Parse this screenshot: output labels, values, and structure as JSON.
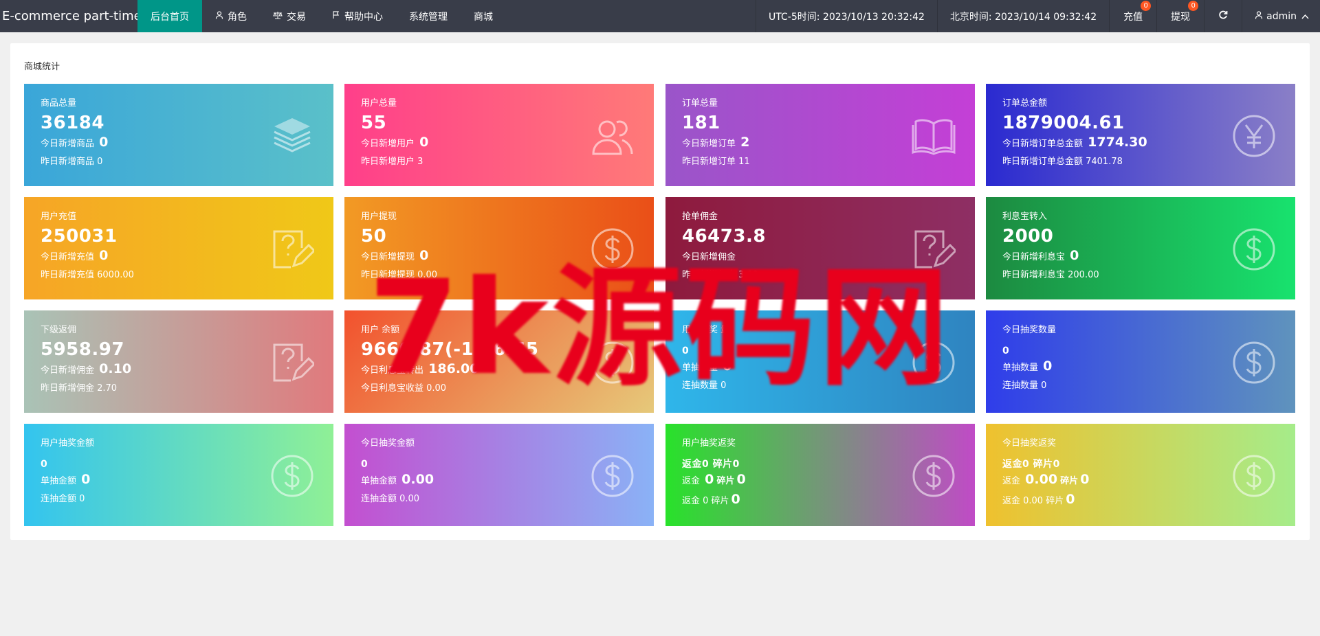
{
  "header": {
    "brand": "E-commerce part-time",
    "nav": [
      {
        "label": "后台首页",
        "icon": "",
        "active": true
      },
      {
        "label": "角色",
        "icon": "user-icon"
      },
      {
        "label": "交易",
        "icon": "scale-icon"
      },
      {
        "label": "帮助中心",
        "icon": "flag-icon"
      },
      {
        "label": "系统管理",
        "icon": ""
      },
      {
        "label": "商城",
        "icon": ""
      }
    ],
    "utc_time": "UTC-5时间: 2023/10/13 20:32:42",
    "beijing_time": "北京时间: 2023/10/14 09:32:42",
    "recharge": {
      "label": "充值",
      "badge": "0"
    },
    "withdraw": {
      "label": "提现",
      "badge": "0"
    },
    "refresh_icon": "refresh-icon",
    "user": {
      "label": "admin",
      "icon": "user-icon"
    }
  },
  "panel": {
    "title": "商城统计"
  },
  "tiles": [
    {
      "title": "商品总量",
      "main": "36184",
      "row1_label": "今日新增商品",
      "row1_value": "0",
      "row2": "昨日新增商品  0",
      "icon": "layers-icon"
    },
    {
      "title": "用户总量",
      "main": "55",
      "row1_label": "今日新增用户",
      "row1_value": "0",
      "row2": "昨日新增用户  3",
      "icon": "users-icon"
    },
    {
      "title": "订单总量",
      "main": "181",
      "row1_label": "今日新增订单",
      "row1_value": "2",
      "row2": "昨日新增订单  11",
      "icon": "book-icon"
    },
    {
      "title": "订单总金额",
      "main": "1879004.61",
      "row1_label": "今日新增订单总金额",
      "row1_value": "1774.30",
      "row2": "昨日新增订单总金额  7401.78",
      "icon": "yen-icon"
    },
    {
      "title": "用户充值",
      "main": "250031",
      "row1_label": "今日新增充值",
      "row1_value": "0",
      "row2": "昨日新增充值  6000.00",
      "icon": "edit-help-icon"
    },
    {
      "title": "用户提现",
      "main": "50",
      "row1_label": "今日新增提现",
      "row1_value": "0",
      "row2": "昨日新增提现  0.00",
      "icon": "dollar-icon"
    },
    {
      "title": "抢单佣金",
      "main": "46473.8",
      "row1_label": "今日新增佣金",
      "row1_value": "",
      "row2": "昨日新增佣金  3  90",
      "icon": "edit-help-icon"
    },
    {
      "title": "利息宝转入",
      "main": "2000",
      "row1_label": "今日新增利息宝",
      "row1_value": "0",
      "row2": "昨日新增利息宝  200.00",
      "icon": "dollar-icon"
    },
    {
      "title": "下级返佣",
      "main": "5958.97",
      "row1_label": "今日新增佣金",
      "row1_value": "0.10",
      "row2": "昨日新增佣金  2.70",
      "icon": "edit-help-icon"
    },
    {
      "title": "用户    余额",
      "main": "  9660.87(-1  56.65",
      "row1_label": "今日利息宝转出",
      "row1_value": "186.00",
      "row2": "今日利息宝收益  0.00",
      "icon": "dollar-icon"
    },
    {
      "title": "用户抽奖    量",
      "main": "0",
      "row1_label": "单抽数量",
      "row1_value": "0",
      "row2": "连抽数量  0",
      "icon": "dollar-icon"
    },
    {
      "title": "今日抽奖数量",
      "main": "0",
      "row1_label": "单抽数量",
      "row1_value": "0",
      "row2": "连抽数量  0",
      "icon": "dollar-icon"
    },
    {
      "title": "用户抽奖金额",
      "main": "0",
      "row1_label": "单抽金额",
      "row1_value": "0",
      "row2": "连抽金额  0",
      "icon": "dollar-icon"
    },
    {
      "title": "今日抽奖金额",
      "main": "0",
      "row1_label": "单抽金额",
      "row1_value": "0.00",
      "row2": "连抽金额  0.00",
      "icon": "dollar-icon"
    },
    {
      "title": "用户抽奖返奖",
      "main": "返金0 碎片0",
      "row1_label": "返金",
      "row1_value": "0",
      "row1_sub": "碎片",
      "row1_sub_value": "0",
      "row2": "返金  0 碎片",
      "row2_value": "0",
      "icon": "dollar-icon"
    },
    {
      "title": "今日抽奖返奖",
      "main": "返金0 碎片0",
      "row1_label": "返金",
      "row1_value": "0.00",
      "row1_sub": "碎片",
      "row1_sub_value": "0",
      "row2": "返金  0.00 碎片",
      "row2_value": "0",
      "icon": "dollar-icon"
    }
  ],
  "watermark": "7k源码网",
  "colors": {
    "topbar": "#393d49",
    "active_nav": "#009688",
    "badge": "#ff5722",
    "watermark": "#e8001c"
  }
}
